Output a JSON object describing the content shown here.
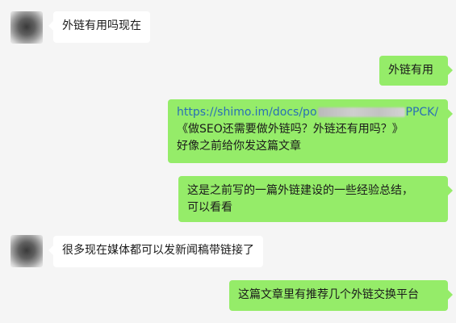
{
  "messages": [
    {
      "side": "left",
      "lines": [
        "外链有用吗现在"
      ]
    },
    {
      "side": "right",
      "lines": [
        "外链有用"
      ]
    },
    {
      "side": "right",
      "link_start": "https://shimo.im/docs/po",
      "link_end": "PPCK/",
      "lines": [
        "《做SEO还需要做外链吗？外链还有用吗？》",
        "好像之前给你发这篇文章"
      ]
    },
    {
      "side": "right",
      "lines": [
        "这是之前写的一篇外链建设的一些经验总结，",
        "可以看看"
      ]
    },
    {
      "side": "left",
      "lines": [
        "很多现在媒体都可以发新闻稿带链接了"
      ]
    },
    {
      "side": "right",
      "lines": [
        "这篇文章里有推荐几个外链交换平台"
      ]
    }
  ],
  "colors": {
    "background": "#f5f5f5",
    "incoming_bubble": "#ffffff",
    "outgoing_bubble": "#95ec69",
    "link": "#2a6fb5"
  }
}
